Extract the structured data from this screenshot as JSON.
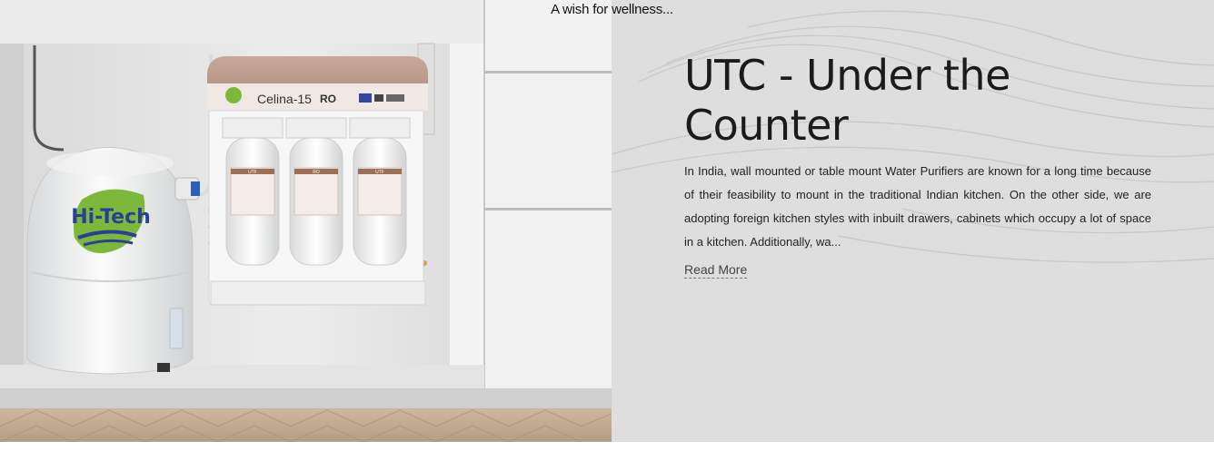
{
  "tagline": "A wish for wellness...",
  "product": {
    "title": "UTC - Under the Counter",
    "description": "In India, wall mounted or table mount Water Purifiers are known for a long time because of their feasibility to mount in the traditional Indian kitchen. On the other side, we are adopting foreign kitchen styles with inbuilt drawers, cabinets which occupy a lot of space in a kitchen. Additionally, wa...",
    "read_more_label": "Read More"
  },
  "image": {
    "brand_logo": "Hi-Tech",
    "model_name": "Celina-15",
    "model_type": "RO",
    "filter_labels": [
      "UTF",
      "RO",
      "UTF"
    ]
  }
}
